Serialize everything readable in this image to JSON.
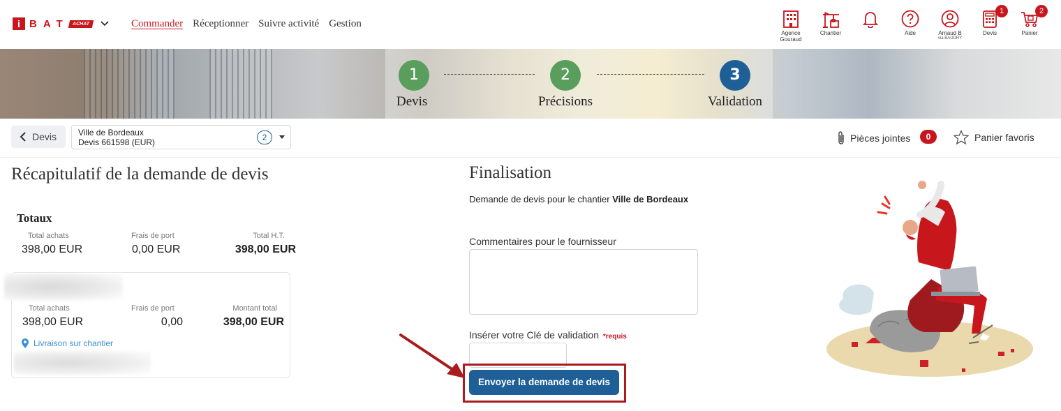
{
  "brand": {
    "logo_i": "i",
    "logo_bat": "BAT",
    "logo_tag": "ACHAT",
    "accent": "#c8161d",
    "primary": "#1f5f97",
    "success": "#5a9e5d"
  },
  "nav": {
    "items": [
      {
        "label": "Commander",
        "active": true
      },
      {
        "label": "Réceptionner",
        "active": false
      },
      {
        "label": "Suivre activité",
        "active": false
      },
      {
        "label": "Gestion",
        "active": false
      }
    ]
  },
  "tools": {
    "agence": {
      "label": "Agence",
      "sub": "Gouraud",
      "icon": "building-icon"
    },
    "chantier": {
      "label": "Chantier",
      "icon": "crane-icon"
    },
    "notif": {
      "icon": "bell-icon"
    },
    "aide": {
      "label": "Aide",
      "icon": "help-icon"
    },
    "user": {
      "label": "Arnaud B",
      "sub": "via BAUDRY",
      "icon": "user-icon"
    },
    "devis": {
      "label": "Devis",
      "badge": "1",
      "icon": "calculator-icon"
    },
    "panier": {
      "label": "Panier",
      "badge": "2",
      "icon": "cart-icon"
    }
  },
  "stepper": {
    "steps": [
      {
        "num": "1",
        "label": "Devis",
        "state": "done"
      },
      {
        "num": "2",
        "label": "Précisions",
        "state": "done"
      },
      {
        "num": "3",
        "label": "Validation",
        "state": "current"
      }
    ]
  },
  "subbar": {
    "back_label": "Devis",
    "select": {
      "line1": "Ville de Bordeaux",
      "line2": "Devis 661598 (EUR)",
      "count": "2"
    },
    "attachments_label": "Pièces jointes",
    "attachments_count": "0",
    "favorites_label": "Panier favoris"
  },
  "recap": {
    "title": "Récapitulatif de la demande de devis",
    "totals_heading": "Totaux",
    "totals": {
      "k1": "Total achats",
      "v1": "398,00 EUR",
      "k2": "Frais de port",
      "v2": "0,00 EUR",
      "k3": "Total H.T.",
      "v3": "398,00 EUR"
    },
    "supplier": {
      "k1": "Total achats",
      "v1": "398,00 EUR",
      "k2": "Frais de port",
      "v2": "0,00",
      "k3": "Montant total",
      "v3": "398,00 EUR",
      "delivery": "Livraison sur chantier"
    }
  },
  "finalisation": {
    "title": "Finalisation",
    "desc_prefix": "Demande de devis pour le chantier ",
    "desc_site": "Ville de Bordeaux",
    "comment_label": "Commentaires pour le fournisseur",
    "comment_value": "",
    "key_label": "Insérer votre Clé de validation",
    "key_required": "*requis",
    "key_value": "",
    "submit_label": "Envoyer la demande de devis"
  }
}
